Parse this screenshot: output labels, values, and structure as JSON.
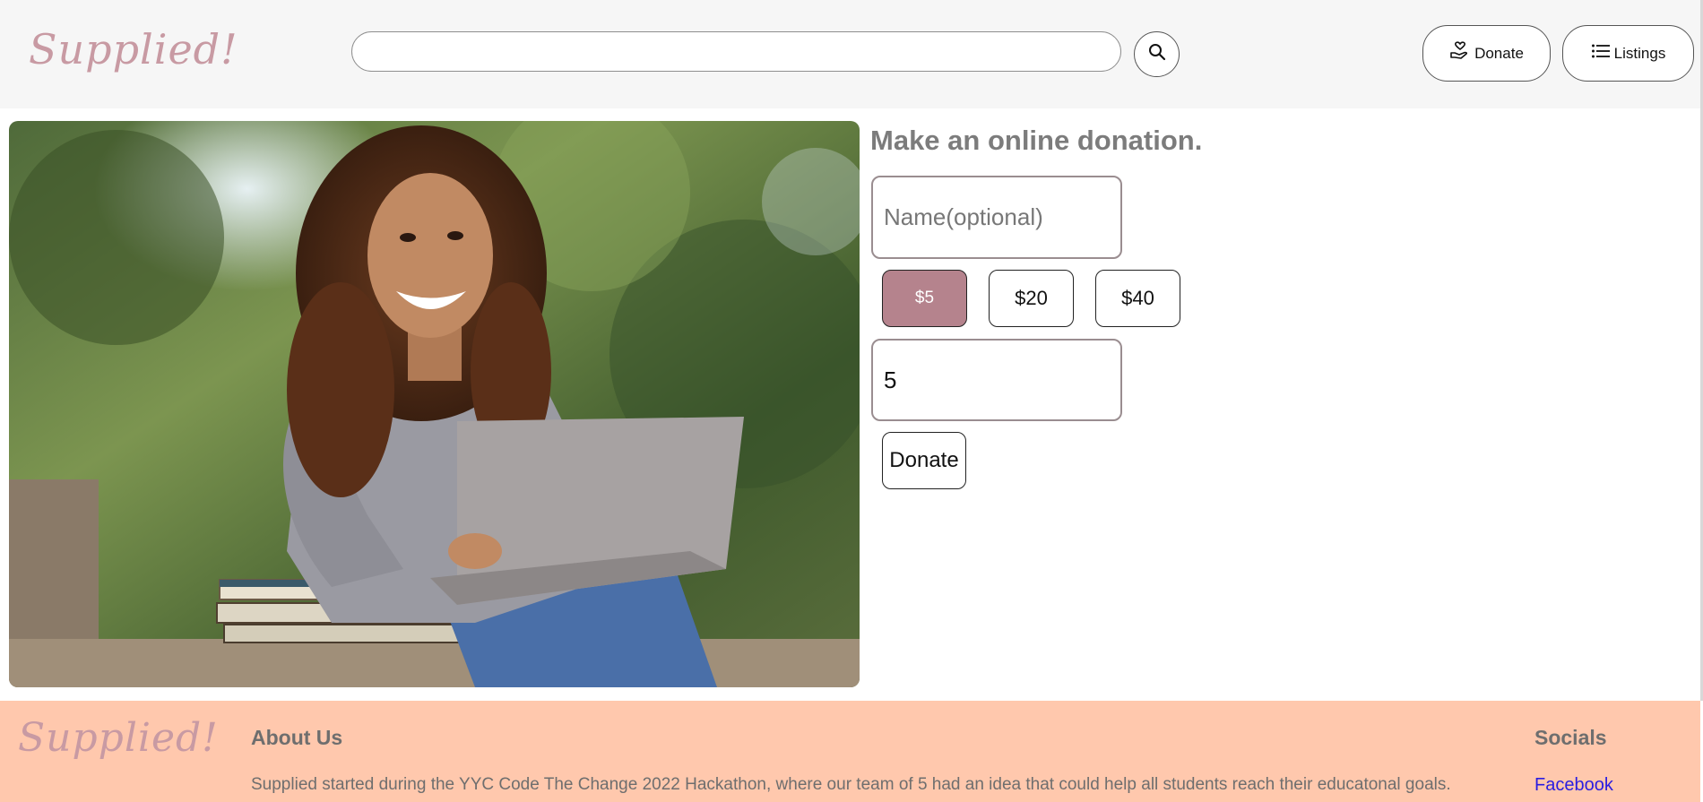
{
  "header": {
    "logo": "Supplied!",
    "search": {
      "value": "",
      "placeholder": ""
    },
    "nav": {
      "donate_label": "Donate",
      "listings_label": "Listings"
    }
  },
  "donation": {
    "title": "Make an online donation.",
    "name_placeholder": "Name(optional)",
    "amount_options": [
      "$5",
      "$20",
      "$40"
    ],
    "selected_amount": "$5",
    "amount_value": "5",
    "submit_label": "Donate"
  },
  "footer": {
    "logo": "Supplied!",
    "about_heading": "About Us",
    "about_text": "Supplied started during the YYC Code The Change 2022 Hackathon, where our team of 5 had an idea that could help all students reach their educatonal goals.",
    "socials_heading": "Socials",
    "facebook_label": "Facebook"
  },
  "colors": {
    "header_bg": "#f6f6f6",
    "logo": "#c89aa3",
    "selected_amount_bg": "#b5838d",
    "footer_bg": "#ffc8ad",
    "link": "#2a1de0"
  },
  "icons": {
    "search": "search-icon",
    "donate": "hand-heart-icon",
    "listings": "list-icon"
  }
}
